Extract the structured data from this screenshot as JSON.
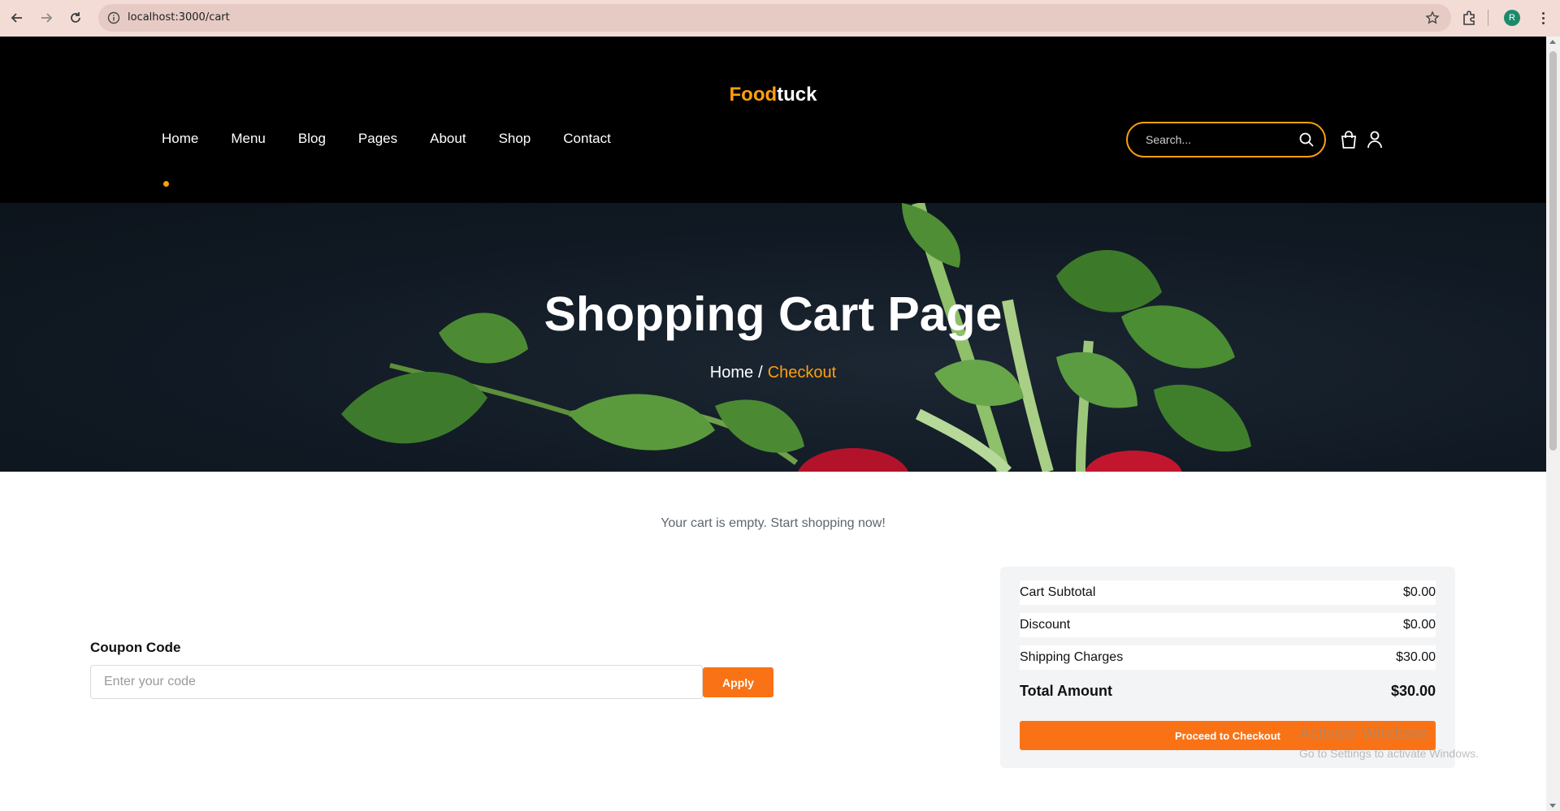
{
  "browser": {
    "url": "localhost:3000/cart",
    "profile_initial": "R"
  },
  "site": {
    "logo_part1": "Food",
    "logo_part2": "tuck",
    "nav": [
      "Home",
      "Menu",
      "Blog",
      "Pages",
      "About",
      "Shop",
      "Contact"
    ],
    "search_placeholder": "Search...",
    "accent_color": "#ff9f0d"
  },
  "hero": {
    "title": "Shopping Cart Page",
    "breadcrumb_home": "Home",
    "breadcrumb_separator": "/",
    "breadcrumb_current": "Checkout"
  },
  "cart": {
    "empty_message": "Your cart is empty. Start shopping now!"
  },
  "coupon": {
    "label": "Coupon Code",
    "placeholder": "Enter your code",
    "button": "Apply"
  },
  "summary": {
    "rows": [
      {
        "label": "Cart Subtotal",
        "value": "$0.00"
      },
      {
        "label": "Discount",
        "value": "$0.00"
      },
      {
        "label": "Shipping Charges",
        "value": "$30.00"
      }
    ],
    "total_label": "Total Amount",
    "total_value": "$30.00",
    "checkout_button": "Proceed to Checkout",
    "button_color": "#f97316"
  },
  "watermark": {
    "line1": "Activate Windows",
    "line2": "Go to Settings to activate Windows."
  }
}
